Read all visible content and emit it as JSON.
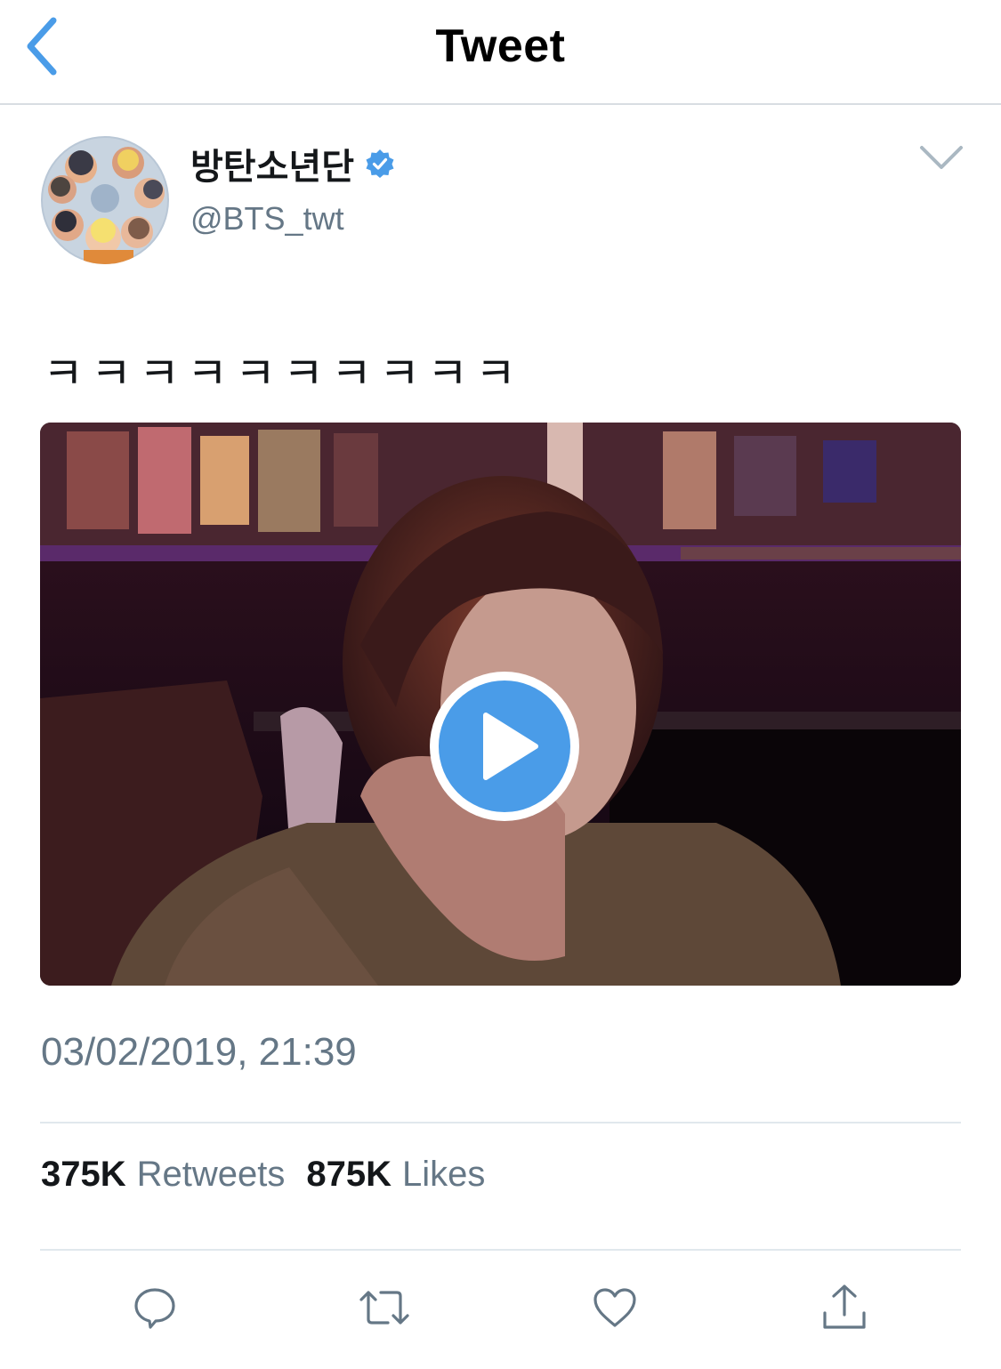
{
  "nav": {
    "title": "Tweet",
    "back_icon": "chevron-left-icon"
  },
  "author": {
    "name": "방탄소년단",
    "verified": true,
    "handle": "@BTS_twt"
  },
  "tweet": {
    "text": "ㅋㅋㅋㅋㅋㅋㅋㅋㅋㅋ",
    "media": {
      "type": "video",
      "play_icon": "play-icon"
    },
    "timestamp": "03/02/2019, 21:39"
  },
  "stats": {
    "retweets_count": "375K",
    "retweets_label": "Retweets",
    "likes_count": "875K",
    "likes_label": "Likes"
  },
  "actions": [
    "reply-icon",
    "retweet-icon",
    "like-icon",
    "share-icon"
  ],
  "colors": {
    "accent": "#4a9ce8",
    "secondary_text": "#657786",
    "icon": "#657786"
  }
}
